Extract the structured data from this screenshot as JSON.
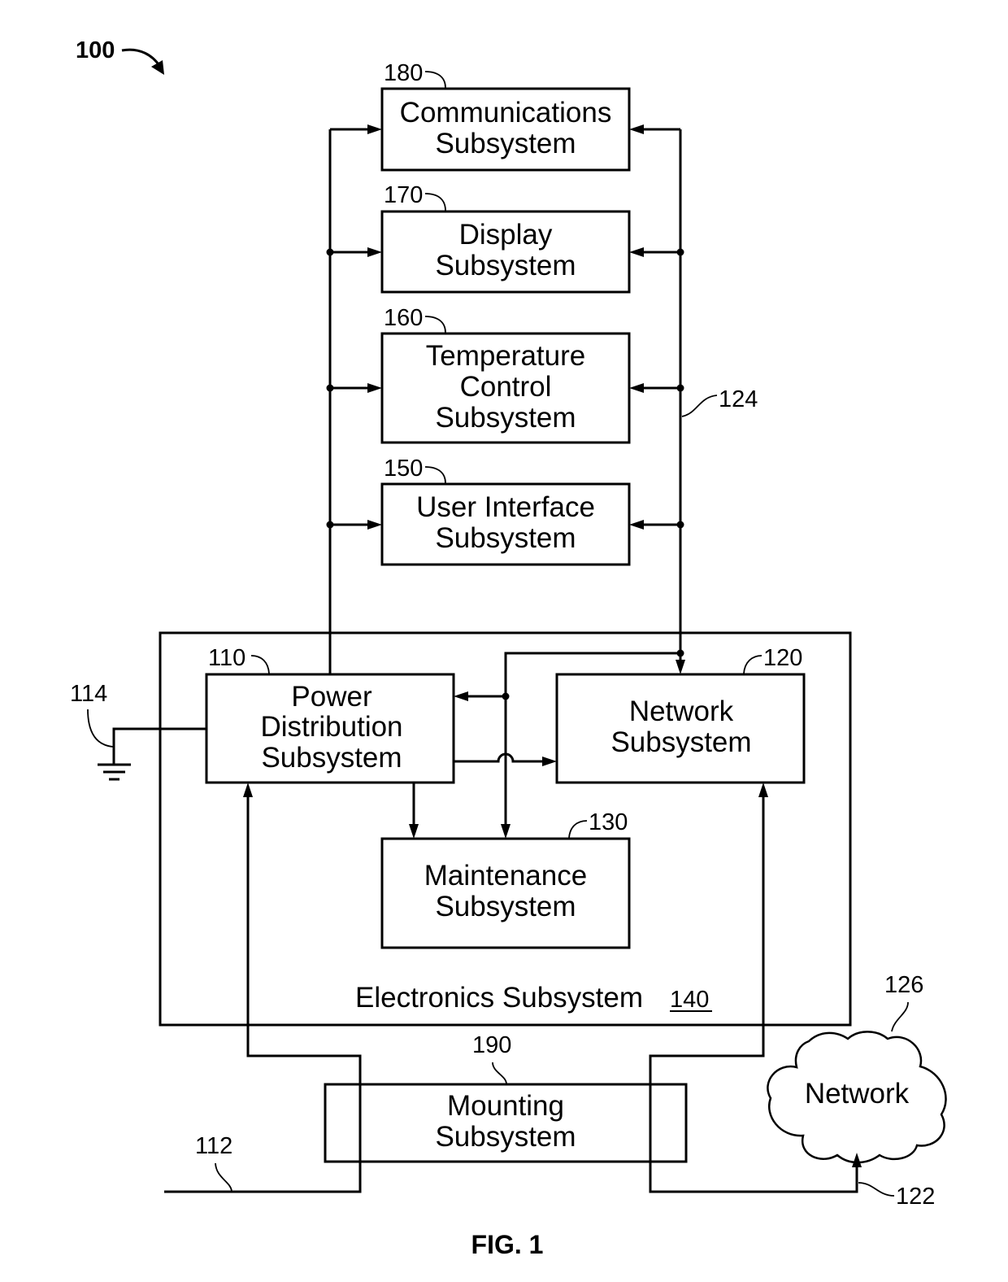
{
  "figure": {
    "ref": "100",
    "caption": "FIG. 1"
  },
  "blocks": {
    "communications": {
      "ref": "180",
      "lines": [
        "Communications",
        "Subsystem"
      ]
    },
    "display": {
      "ref": "170",
      "lines": [
        "Display",
        "Subsystem"
      ]
    },
    "temperature": {
      "ref": "160",
      "lines": [
        "Temperature",
        "Control",
        "Subsystem"
      ]
    },
    "user_interface": {
      "ref": "150",
      "lines": [
        "User Interface",
        "Subsystem"
      ]
    },
    "power": {
      "ref": "110",
      "lines": [
        "Power",
        "Distribution",
        "Subsystem"
      ]
    },
    "network_subsystem": {
      "ref": "120",
      "lines": [
        "Network",
        "Subsystem"
      ]
    },
    "maintenance": {
      "ref": "130",
      "lines": [
        "Maintenance",
        "Subsystem"
      ]
    },
    "electronics": {
      "ref": "140",
      "label": "Electronics Subsystem"
    },
    "mounting": {
      "ref": "190",
      "lines": [
        "Mounting",
        "Subsystem"
      ]
    },
    "network_cloud": {
      "ref": "126",
      "label": "Network"
    }
  },
  "connections": {
    "ground_ref": "114",
    "power_input_ref": "112",
    "network_link_ref": "122",
    "data_bus_ref": "124"
  }
}
